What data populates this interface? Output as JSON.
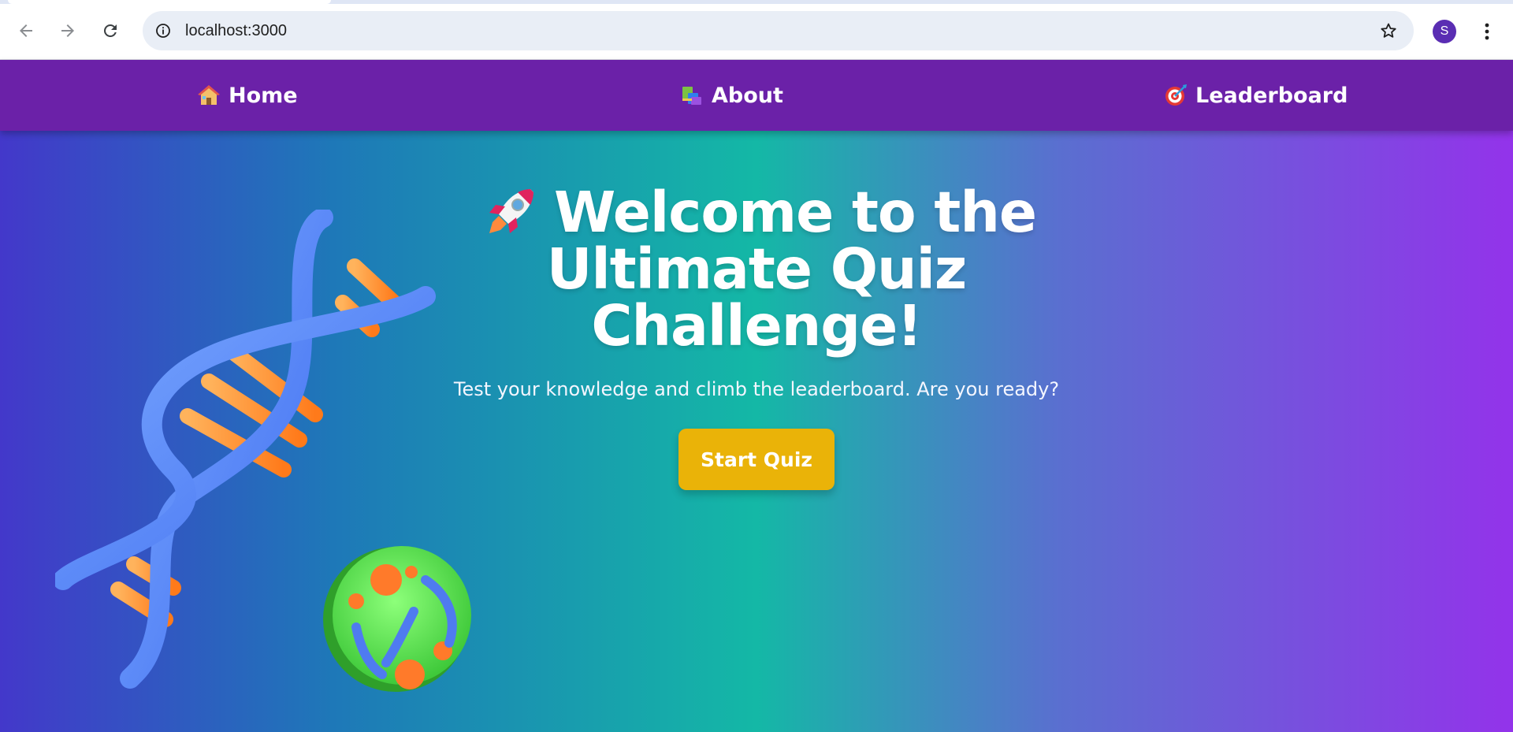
{
  "browser": {
    "url": "localhost:3000",
    "profile_initial": "S",
    "icons": {
      "back": "arrow-left-icon",
      "forward": "arrow-right-icon",
      "reload": "reload-icon",
      "site_info": "info-icon",
      "bookmark": "star-icon",
      "menu": "kebab-menu-icon"
    }
  },
  "nav": {
    "items": [
      {
        "label": "Home",
        "icon": "house-icon"
      },
      {
        "label": "About",
        "icon": "books-icon"
      },
      {
        "label": "Leaderboard",
        "icon": "target-icon"
      }
    ],
    "background": "#6b21a8"
  },
  "hero": {
    "title_line1": "Welcome to the",
    "title_line2": "Ultimate Quiz",
    "title_line3": "Challenge!",
    "title_icon": "rocket-icon",
    "subtitle": "Test your knowledge and climb the leaderboard. Are you ready?",
    "cta_label": "Start Quiz",
    "cta_color": "#eab308",
    "illustration": "dna-helix-and-cell-illustration"
  }
}
